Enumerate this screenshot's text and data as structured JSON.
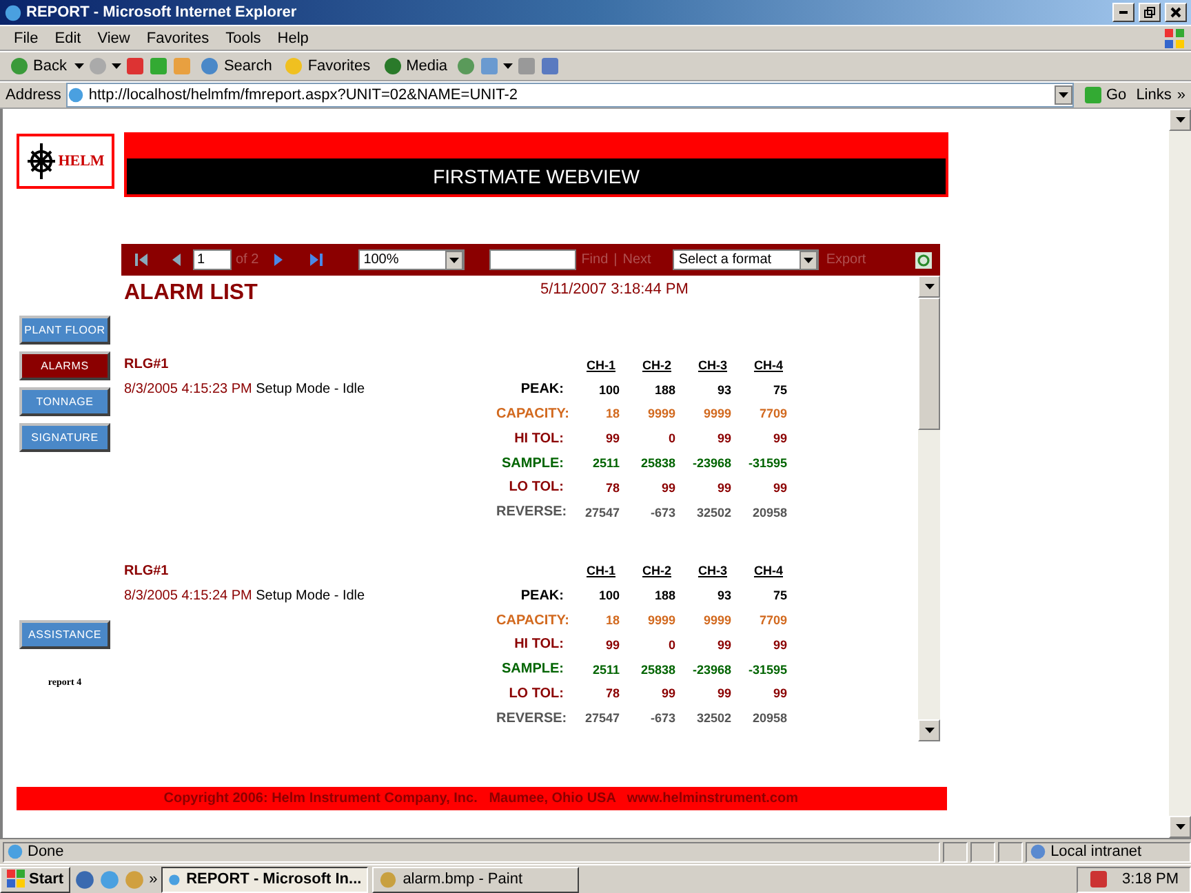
{
  "window": {
    "title": "REPORT - Microsoft Internet Explorer"
  },
  "menu": [
    "File",
    "Edit",
    "View",
    "Favorites",
    "Tools",
    "Help"
  ],
  "toolbar": {
    "back": "Back",
    "search": "Search",
    "favorites": "Favorites",
    "media": "Media"
  },
  "address": {
    "label": "Address",
    "url": "http://localhost/helmfm/fmreport.aspx?UNIT=02&NAME=UNIT-2",
    "go": "Go",
    "links": "Links",
    "more": "»"
  },
  "page": {
    "logo": "HELM",
    "banner": "FIRSTMATE WEBVIEW",
    "nav": [
      {
        "label": "PLANT FLOOR",
        "selected": false
      },
      {
        "label": "ALARMS",
        "selected": true
      },
      {
        "label": "TONNAGE",
        "selected": false
      },
      {
        "label": "SIGNATURE",
        "selected": false
      }
    ],
    "assistance": "ASSISTANCE",
    "report_note": "report 4",
    "footer": "Copyright 2006: Helm Instrument Company, Inc.   Maumee, Ohio USA   www.helminstrument.com"
  },
  "report_toolbar": {
    "page": "1",
    "page_count": "of 2",
    "zoom": "100%",
    "find": "Find",
    "separator": "|",
    "next": "Next",
    "format": "Select a format",
    "export": "Export"
  },
  "report": {
    "title": "ALARM LIST",
    "timestamp": "5/11/2007 3:18:44 PM",
    "sections": [
      {
        "unit": "RLG#1",
        "time": "8/3/2005 4:15:23 PM",
        "message": "Setup Mode - Idle",
        "columns": [
          "CH-1",
          "CH-2",
          "CH-3",
          "CH-4"
        ],
        "rows": [
          {
            "label": "PEAK:",
            "color": "#000000",
            "values": [
              "100",
              "188",
              "93",
              "75"
            ]
          },
          {
            "label": "CAPACITY:",
            "color": "#d2691e",
            "values": [
              "18",
              "9999",
              "9999",
              "7709"
            ]
          },
          {
            "label": "HI TOL:",
            "color": "#8b0000",
            "values": [
              "99",
              "0",
              "99",
              "99"
            ]
          },
          {
            "label": "SAMPLE:",
            "color": "#006400",
            "values": [
              "2511",
              "25838",
              "-23968",
              "-31595"
            ]
          },
          {
            "label": "LO TOL:",
            "color": "#8b0000",
            "values": [
              "78",
              "99",
              "99",
              "99"
            ]
          },
          {
            "label": "REVERSE:",
            "color": "#555555",
            "values": [
              "27547",
              "-673",
              "32502",
              "20958"
            ]
          }
        ]
      },
      {
        "unit": "RLG#1",
        "time": "8/3/2005 4:15:24 PM",
        "message": "Setup Mode - Idle",
        "columns": [
          "CH-1",
          "CH-2",
          "CH-3",
          "CH-4"
        ],
        "rows": [
          {
            "label": "PEAK:",
            "color": "#000000",
            "values": [
              "100",
              "188",
              "93",
              "75"
            ]
          },
          {
            "label": "CAPACITY:",
            "color": "#d2691e",
            "values": [
              "18",
              "9999",
              "9999",
              "7709"
            ]
          },
          {
            "label": "HI TOL:",
            "color": "#8b0000",
            "values": [
              "99",
              "0",
              "99",
              "99"
            ]
          },
          {
            "label": "SAMPLE:",
            "color": "#006400",
            "values": [
              "2511",
              "25838",
              "-23968",
              "-31595"
            ]
          },
          {
            "label": "LO TOL:",
            "color": "#8b0000",
            "values": [
              "78",
              "99",
              "99",
              "99"
            ]
          },
          {
            "label": "REVERSE:",
            "color": "#555555",
            "values": [
              "27547",
              "-673",
              "32502",
              "20958"
            ]
          }
        ]
      }
    ]
  },
  "status_bar": {
    "text": "Done",
    "zone": "Local intranet"
  },
  "taskbar": {
    "start": "Start",
    "more": "»",
    "tasks": [
      {
        "label": "REPORT - Microsoft In...",
        "selected": true
      },
      {
        "label": "alarm.bmp - Paint",
        "selected": false
      }
    ],
    "clock": "3:18 PM"
  }
}
